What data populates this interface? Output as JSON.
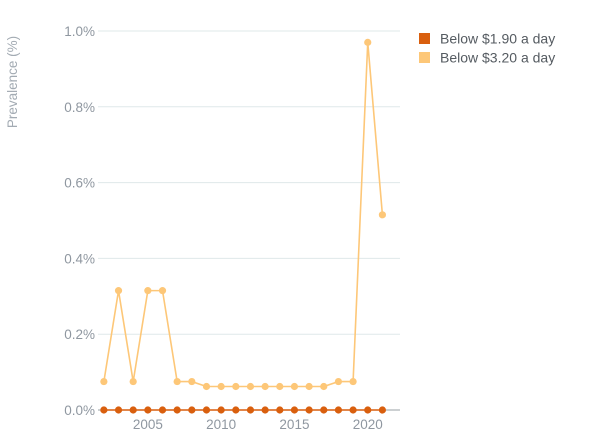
{
  "chart_data": {
    "type": "line",
    "title": "",
    "xlabel": "",
    "ylabel": "Prevalence (%)",
    "xlim": [
      2001.6,
      2022.2
    ],
    "ylim": [
      0,
      1.0
    ],
    "x_ticks": [
      2005,
      2010,
      2015,
      2020
    ],
    "y_ticks": [
      0,
      0.2,
      0.4,
      0.6,
      0.8,
      1.0
    ],
    "y_tick_labels": [
      "0.0%",
      "0.2%",
      "0.4%",
      "0.6%",
      "0.8%",
      "1.0%"
    ],
    "grid": "horizontal",
    "legend": "top-right",
    "x": [
      2002,
      2003,
      2004,
      2005,
      2006,
      2007,
      2008,
      2009,
      2010,
      2011,
      2012,
      2013,
      2014,
      2015,
      2016,
      2017,
      2018,
      2019,
      2020,
      2021
    ],
    "series": [
      {
        "name": "Below $1.90 a day",
        "color": "#d95f0e",
        "values": [
          0,
          0,
          0,
          0,
          0,
          0,
          0,
          0,
          0,
          0,
          0,
          0,
          0,
          0,
          0,
          0,
          0,
          0,
          0,
          0
        ]
      },
      {
        "name": "Below $3.20 a day",
        "color": "#fdc778",
        "values": [
          0.075,
          0.315,
          0.075,
          0.315,
          0.315,
          0.075,
          0.075,
          0.062,
          0.062,
          0.062,
          0.062,
          0.062,
          0.062,
          0.062,
          0.062,
          0.062,
          0.075,
          0.075,
          0.97,
          0.515
        ]
      }
    ]
  }
}
